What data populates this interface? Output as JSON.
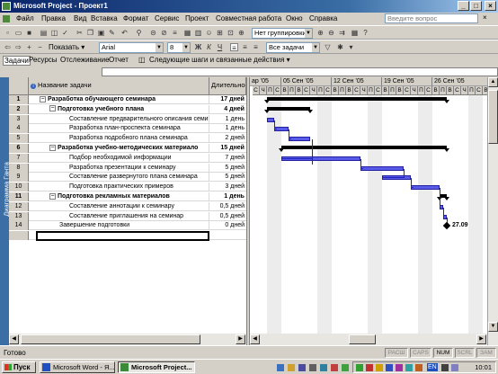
{
  "window": {
    "title": "Microsoft Project - Проект1"
  },
  "menu": {
    "items": [
      "Файл",
      "Правка",
      "Вид",
      "Вставка",
      "Формат",
      "Сервис",
      "Проект",
      "Совместная работа",
      "Окно",
      "Справка"
    ],
    "ask_placeholder": "Введите вопрос"
  },
  "toolbar": {
    "grouping": "Нет группировки",
    "show_label": "Показать",
    "font": "Arial",
    "size": "8",
    "bold": "Ж",
    "italic": "К",
    "underline": "Ч",
    "filter": "Все задачи"
  },
  "guide": {
    "items": [
      "Задачи",
      "Ресурсы",
      "Отслеживание",
      "Отчет"
    ],
    "next_steps": "Следующие шаги и связанные действия"
  },
  "view_bar": "Диаграмма Ганта",
  "table": {
    "col_name": "Название задачи",
    "col_dur": "Длительность",
    "rows": [
      {
        "id": "1",
        "name": "Разработка обучающего семинара",
        "dur": "17 дней",
        "level": 0,
        "bold": true,
        "toggle": "−"
      },
      {
        "id": "2",
        "name": "Подготовка учебного плана",
        "dur": "4 дней",
        "level": 1,
        "bold": true,
        "toggle": "−"
      },
      {
        "id": "3",
        "name": "Составление предварительного описания семи",
        "dur": "1 день",
        "level": 2,
        "bold": false,
        "toggle": ""
      },
      {
        "id": "4",
        "name": "Разработка план-проспекта семинара",
        "dur": "1 день",
        "level": 2,
        "bold": false,
        "toggle": ""
      },
      {
        "id": "5",
        "name": "Разработка подробного плана семинара",
        "dur": "2 дней",
        "level": 2,
        "bold": false,
        "toggle": ""
      },
      {
        "id": "6",
        "name": "Разработка учебно-методических материало",
        "dur": "15 дней",
        "level": 1,
        "bold": true,
        "toggle": "−"
      },
      {
        "id": "7",
        "name": "Подбор необходимой информации",
        "dur": "7 дней",
        "level": 2,
        "bold": false,
        "toggle": ""
      },
      {
        "id": "8",
        "name": "Разработка презентации к семинару",
        "dur": "5 дней",
        "level": 2,
        "bold": false,
        "toggle": ""
      },
      {
        "id": "9",
        "name": "Составление  развернутого плана семинара",
        "dur": "5 дней",
        "level": 2,
        "bold": false,
        "toggle": ""
      },
      {
        "id": "10",
        "name": "Подготовка практических примеров",
        "dur": "3 дней",
        "level": 2,
        "bold": false,
        "toggle": ""
      },
      {
        "id": "11",
        "name": "Подготовка рекламных материалов",
        "dur": "1 день",
        "level": 1,
        "bold": true,
        "toggle": "−"
      },
      {
        "id": "12",
        "name": "Составление аннотации к семинару",
        "dur": "0,5 дней",
        "level": 2,
        "bold": false,
        "toggle": ""
      },
      {
        "id": "13",
        "name": "Составление приглашения на семинар",
        "dur": "0,5 дней",
        "level": 2,
        "bold": false,
        "toggle": ""
      },
      {
        "id": "14",
        "name": "Завершение подготовки",
        "dur": "0 дней",
        "level": 1,
        "bold": false,
        "toggle": ""
      }
    ]
  },
  "gantt": {
    "weeks": [
      "ap '05",
      "05 Сен '05",
      "12 Сен '05",
      "19 Сен '05",
      "26 Сен '05"
    ],
    "days": [
      "С",
      "Ч",
      "П",
      "С",
      "В",
      "П",
      "В",
      "С",
      "Ч",
      "П",
      "С",
      "В",
      "П",
      "В",
      "С",
      "Ч",
      "П",
      "С",
      "В",
      "П",
      "В",
      "С",
      "Ч",
      "П",
      "С",
      "В",
      "П",
      "В",
      "С",
      "Ч",
      "П",
      "С",
      "В"
    ],
    "milestone_label": "27.09"
  },
  "status": {
    "text": "Готово",
    "indicators": [
      "РАСШ",
      "CAPS",
      "NUM",
      "SCRL",
      "ЗАМ"
    ]
  },
  "taskbar": {
    "start": "Пуск",
    "buttons": [
      "Microsoft Word - Я...",
      "Microsoft Project..."
    ],
    "tray_lang": "EN",
    "clock": "10:01"
  }
}
